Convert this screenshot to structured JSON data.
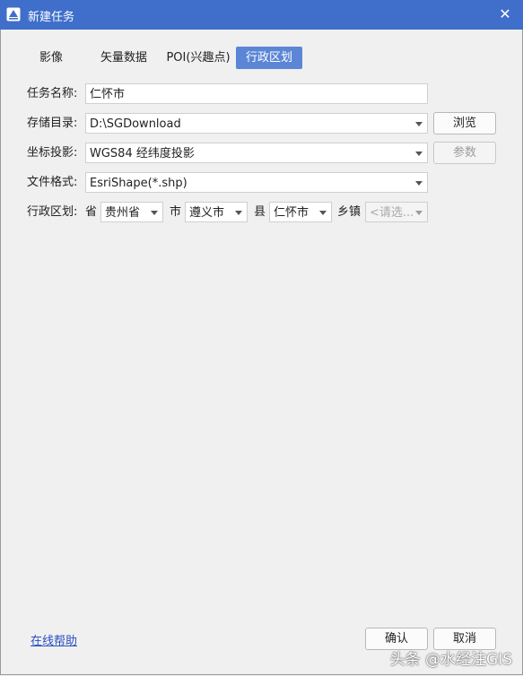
{
  "window": {
    "title": "新建任务",
    "close_glyph": "✕"
  },
  "tabs": [
    {
      "label": "影像",
      "active": false
    },
    {
      "label": "矢量数据",
      "active": false
    },
    {
      "label": "POI(兴趣点)",
      "active": false
    },
    {
      "label": "行政区划",
      "active": true
    }
  ],
  "form": {
    "task_name": {
      "label": "任务名称:",
      "value": "仁怀市"
    },
    "storage_dir": {
      "label": "存储目录:",
      "value": "D:\\SGDownload",
      "browse_label": "浏览"
    },
    "projection": {
      "label": "坐标投影:",
      "value": "WGS84 经纬度投影",
      "params_label": "参数"
    },
    "file_format": {
      "label": "文件格式:",
      "value": "EsriShape(*.shp)"
    },
    "region": {
      "label": "行政区划:",
      "province_label": "省",
      "province_value": "贵州省",
      "city_label": "市",
      "city_value": "遵义市",
      "county_label": "县",
      "county_value": "仁怀市",
      "town_label": "乡镇",
      "town_value": "<请选..."
    }
  },
  "footer": {
    "help_link": "在线帮助",
    "confirm_label": "确认",
    "cancel_label": "取消"
  },
  "watermark": "头条 @水经注GIS",
  "colors": {
    "titlebar": "#3f6fca",
    "active_tab": "#5b86d6"
  }
}
